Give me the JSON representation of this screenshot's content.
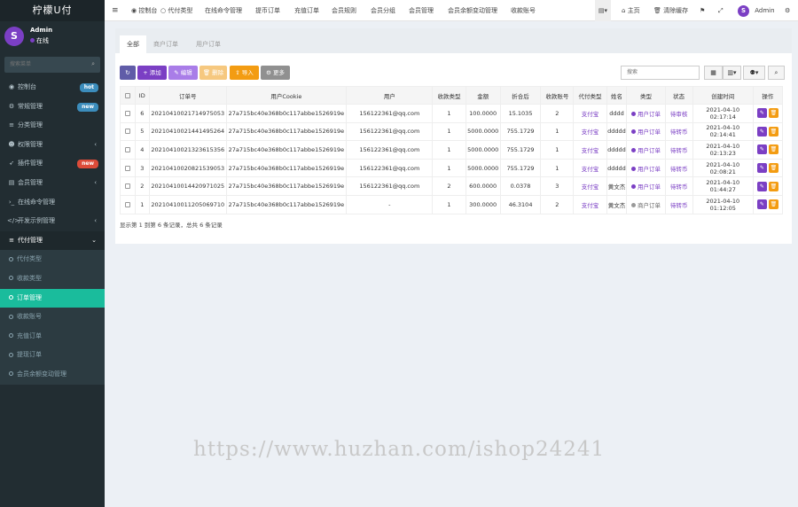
{
  "sidebar": {
    "app_title": "柠檬U付",
    "user_name": "Admin",
    "user_status": "在线",
    "avatar_letter": "S",
    "search_placeholder": "搜索菜单",
    "items": [
      {
        "icon": "dashboard-icon",
        "glyph": "◉",
        "label": "控制台",
        "badge": "hot",
        "badge_color": "#3c8dbc"
      },
      {
        "icon": "gear-icon",
        "glyph": "⚙",
        "label": "常规管理",
        "badge": "new",
        "badge_color": "#3c8dbc"
      },
      {
        "icon": "list-icon",
        "glyph": "≡",
        "label": "分类管理"
      },
      {
        "icon": "users-icon",
        "glyph": "☻",
        "label": "权限管理",
        "arrow": "‹"
      },
      {
        "icon": "rocket-icon",
        "glyph": "➶",
        "label": "插件管理",
        "badge": "new",
        "badge_color": "#dd4b39"
      },
      {
        "icon": "folder-icon",
        "glyph": "▤",
        "label": "会员管理",
        "arrow": "‹"
      },
      {
        "icon": "terminal-icon",
        "glyph": "›_",
        "label": "在线命令管理"
      },
      {
        "icon": "code-icon",
        "glyph": "</>",
        "label": "开发示例管理",
        "arrow": "‹"
      },
      {
        "icon": "list-icon",
        "glyph": "≡",
        "label": "代付管理",
        "arrow": "⌄",
        "open": true
      }
    ],
    "submenu": [
      {
        "label": "代付类型"
      },
      {
        "label": "收款类型"
      },
      {
        "label": "订单管理",
        "active": true
      },
      {
        "label": "收款账号"
      },
      {
        "label": "充值订单"
      },
      {
        "label": "提现订单"
      },
      {
        "label": "会员余额变动管理"
      }
    ]
  },
  "topnav": {
    "menu_icon": "≡",
    "items": [
      {
        "label": "控制台",
        "icon": "◉"
      },
      {
        "label": "代付类型",
        "icon": "○"
      },
      {
        "label": "在线命令管理"
      },
      {
        "label": "提币订单"
      },
      {
        "label": "充值订单"
      },
      {
        "label": "会员规则"
      },
      {
        "label": "会员分组"
      },
      {
        "label": "会员管理"
      },
      {
        "label": "会员余额变动管理"
      },
      {
        "label": "收款账号"
      }
    ],
    "right": {
      "home": "主页",
      "clear_cache": "清除缓存",
      "admin": "Admin"
    }
  },
  "tabs": [
    "全部",
    "商户订单",
    "用户订单"
  ],
  "toolbar": {
    "refresh": "↻",
    "add": "+ 添加",
    "edit": "✎ 编辑",
    "delete": "🗑 删除",
    "import": "⇪ 导入",
    "more": "⚙ 更多",
    "search_placeholder": "搜索"
  },
  "colors": {
    "primary": "#605ca8",
    "purple": "#7b3fc4",
    "violet": "#a97de8",
    "orange": "#f39c12",
    "light_orange": "#f6c87f",
    "grey": "#909090",
    "active_menu": "#1abc9c"
  },
  "table": {
    "headers": [
      "ID",
      "订单号",
      "用户Cookie",
      "用户",
      "收款类型",
      "金额",
      "折合后",
      "收款账号",
      "代付类型",
      "姓名",
      "类型",
      "状态",
      "创建时间",
      "操作"
    ],
    "rows": [
      {
        "id": "6",
        "order": "20210410021714975053",
        "cookie": "27a715bc40e368b0c117abbe1526919e",
        "user": "156122361@qq.com",
        "pay_type": "1",
        "amount": "100.0000",
        "converted": "15.1035",
        "account": "2",
        "dai_type": "支付宝",
        "name": "dddd",
        "type": "用户订单",
        "type_dot": "purple",
        "status": "待审核"
      },
      {
        "id": "5",
        "order": "20210410021441495264",
        "cookie": "27a715bc40e368b0c117abbe1526919e",
        "user": "156122361@qq.com",
        "pay_type": "1",
        "amount": "5000.0000",
        "converted": "755.1729",
        "account": "1",
        "dai_type": "支付宝",
        "name": "ddddd",
        "type": "用户订单",
        "type_dot": "purple",
        "status": "待转币"
      },
      {
        "id": "4",
        "order": "20210410021323615356",
        "cookie": "27a715bc40e368b0c117abbe1526919e",
        "user": "156122361@qq.com",
        "pay_type": "1",
        "amount": "5000.0000",
        "converted": "755.1729",
        "account": "1",
        "dai_type": "支付宝",
        "name": "ddddd",
        "type": "用户订单",
        "type_dot": "purple",
        "status": "待转币"
      },
      {
        "id": "3",
        "order": "20210410020821539053",
        "cookie": "27a715bc40e368b0c117abbe1526919e",
        "user": "156122361@qq.com",
        "pay_type": "1",
        "amount": "5000.0000",
        "converted": "755.1729",
        "account": "1",
        "dai_type": "支付宝",
        "name": "ddddd",
        "type": "用户订单",
        "type_dot": "purple",
        "status": "待转币"
      },
      {
        "id": "2",
        "order": "20210410014420971025",
        "cookie": "27a715bc40e368b0c117abbe1526919e",
        "user": "156122361@qq.com",
        "pay_type": "2",
        "amount": "600.0000",
        "converted": "0.0378",
        "account": "3",
        "dai_type": "支付宝",
        "name": "黄文杰",
        "type": "用户订单",
        "type_dot": "purple",
        "status": "待转币"
      },
      {
        "id": "1",
        "order": "20210410011205069710",
        "cookie": "27a715bc40e368b0c117abbe1526919e",
        "user": "-",
        "pay_type": "1",
        "amount": "300.0000",
        "converted": "46.3104",
        "account": "2",
        "dai_type": "支付宝",
        "name": "黄文杰",
        "type": "商户订单",
        "type_dot": "grey",
        "status": "待转币"
      }
    ],
    "created": [
      "2021-04-10 02:17:14",
      "2021-04-10 02:14:41",
      "2021-04-10 02:13:23",
      "2021-04-10 02:08:21",
      "2021-04-10 01:44:27",
      "2021-04-10 01:12:05"
    ]
  },
  "summary": "显示第 1 到第 6 条记录，总共 6 条记录",
  "watermark": "https://www.huzhan.com/ishop24241"
}
